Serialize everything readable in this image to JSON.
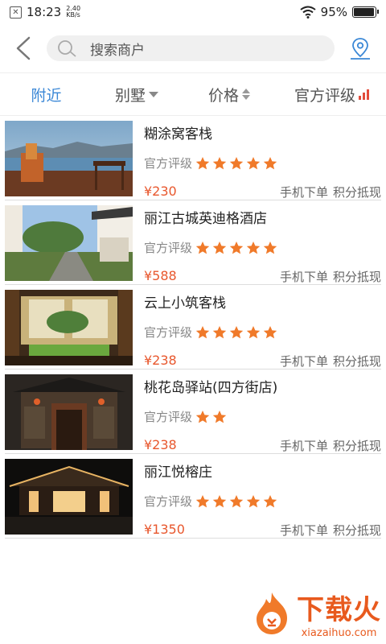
{
  "status": {
    "time": "18:23",
    "speed_value": "2.40",
    "speed_unit": "KB/s",
    "battery": "95%"
  },
  "header": {
    "search_placeholder": "搜索商户"
  },
  "filters": {
    "nearby": "附近",
    "type": "别墅",
    "price": "价格",
    "rating": "官方评级"
  },
  "items": [
    {
      "name": "糊涂窝客栈",
      "rating_label": "官方评级",
      "stars": 5,
      "price": "¥230",
      "tag1": "手机下单",
      "tag2": "积分抵现"
    },
    {
      "name": "丽江古城英迪格酒店",
      "rating_label": "官方评级",
      "stars": 5,
      "price": "¥588",
      "tag1": "手机下单",
      "tag2": "积分抵现"
    },
    {
      "name": "云上小筑客栈",
      "rating_label": "官方评级",
      "stars": 5,
      "price": "¥238",
      "tag1": "手机下单",
      "tag2": "积分抵现"
    },
    {
      "name": "桃花岛驿站(四方街店)",
      "rating_label": "官方评级",
      "stars": 2,
      "price": "¥238",
      "tag1": "手机下单",
      "tag2": "积分抵现"
    },
    {
      "name": "丽江悦榕庄",
      "rating_label": "官方评级",
      "stars": 5,
      "price": "¥1350",
      "tag1": "手机下单",
      "tag2": "积分抵现"
    }
  ],
  "watermark": {
    "main": "下载火",
    "sub": "xiazaihuo.com"
  },
  "colors": {
    "accent": "#3a87d6",
    "price": "#e8572d",
    "star": "#f07a2a"
  }
}
